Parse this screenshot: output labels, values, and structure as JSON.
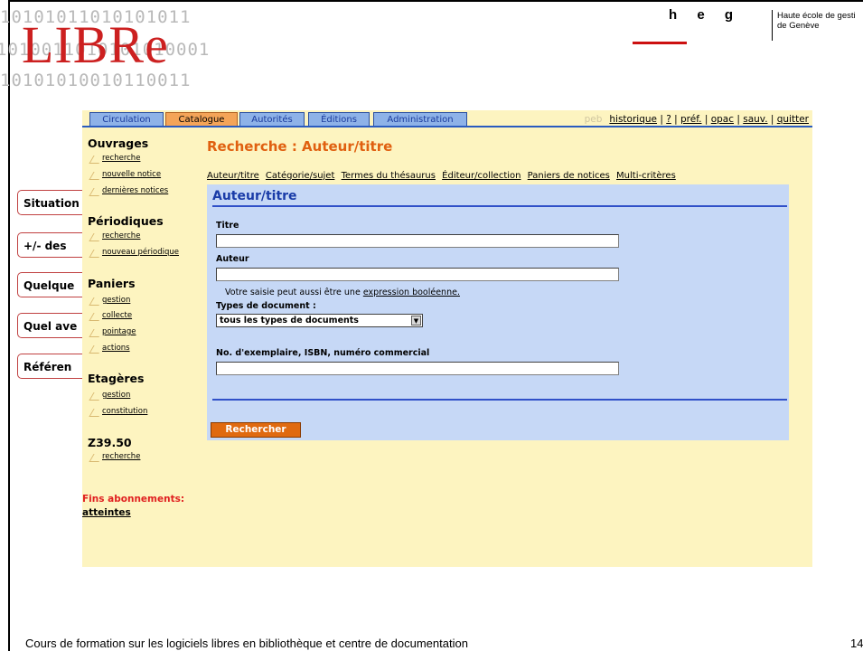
{
  "logo": {
    "bits_rows": [
      "10101011010101011",
      "1010011010101010001",
      "10101010010110011"
    ],
    "word": "LIBRe"
  },
  "heg": {
    "letters": "h e g",
    "school_line1": "Haute école de gesti",
    "school_line2": "de Genève"
  },
  "side_buttons": [
    "Situation",
    "+/- des",
    "Quelque",
    "Quel ave",
    "Référen"
  ],
  "tabs": [
    {
      "label": "Circulation",
      "active": false
    },
    {
      "label": "Catalogue",
      "active": true
    },
    {
      "label": "Autorités",
      "active": false
    },
    {
      "label": "Éditions",
      "active": false
    },
    {
      "label": "Administration",
      "active": false
    }
  ],
  "toplinks": {
    "faint": "peb",
    "historique": "historique",
    "help": "?",
    "pref": "préf.",
    "opac": "opac",
    "sauv": "sauv.",
    "quitter": "quitter"
  },
  "menu": {
    "ouvrages": "Ouvrages",
    "ouvrages_items": [
      "recherche",
      "nouvelle notice",
      "dernières notices"
    ],
    "periodiques": "Périodiques",
    "periodiques_items": [
      "recherche",
      "nouveau périodique"
    ],
    "paniers": "Paniers",
    "paniers_items": [
      "gestion",
      "collecte",
      "pointage",
      "actions"
    ],
    "etageres": "Etagères",
    "etageres_items": [
      "gestion",
      "constitution"
    ],
    "z3950": "Z39.50",
    "z3950_items": [
      "recherche"
    ],
    "fins": "Fins abonnements:",
    "atteintes": "atteintes"
  },
  "main": {
    "title": "Recherche : Auteur/titre",
    "sublinks": [
      "Auteur/titre",
      "Catégorie/sujet",
      "Termes du thésaurus",
      "Éditeur/collection",
      "Paniers de notices",
      "Multi-critères"
    ]
  },
  "panel": {
    "title": "Auteur/titre",
    "titre_label": "Titre",
    "titre_value": "",
    "auteur_label": "Auteur",
    "auteur_value": "",
    "hint_prefix": "Votre saisie peut aussi être une ",
    "hint_link": "expression booléenne.",
    "type_label": "Types de document :",
    "type_selected": "tous les types de documents",
    "numero_label": "No. d'exemplaire, ISBN, numéro commercial",
    "numero_value": "",
    "search_button": "Rechercher"
  },
  "footer": {
    "text": "Cours de formation sur les logiciels libres en bibliothèque et centre de documentation",
    "page": "14"
  }
}
